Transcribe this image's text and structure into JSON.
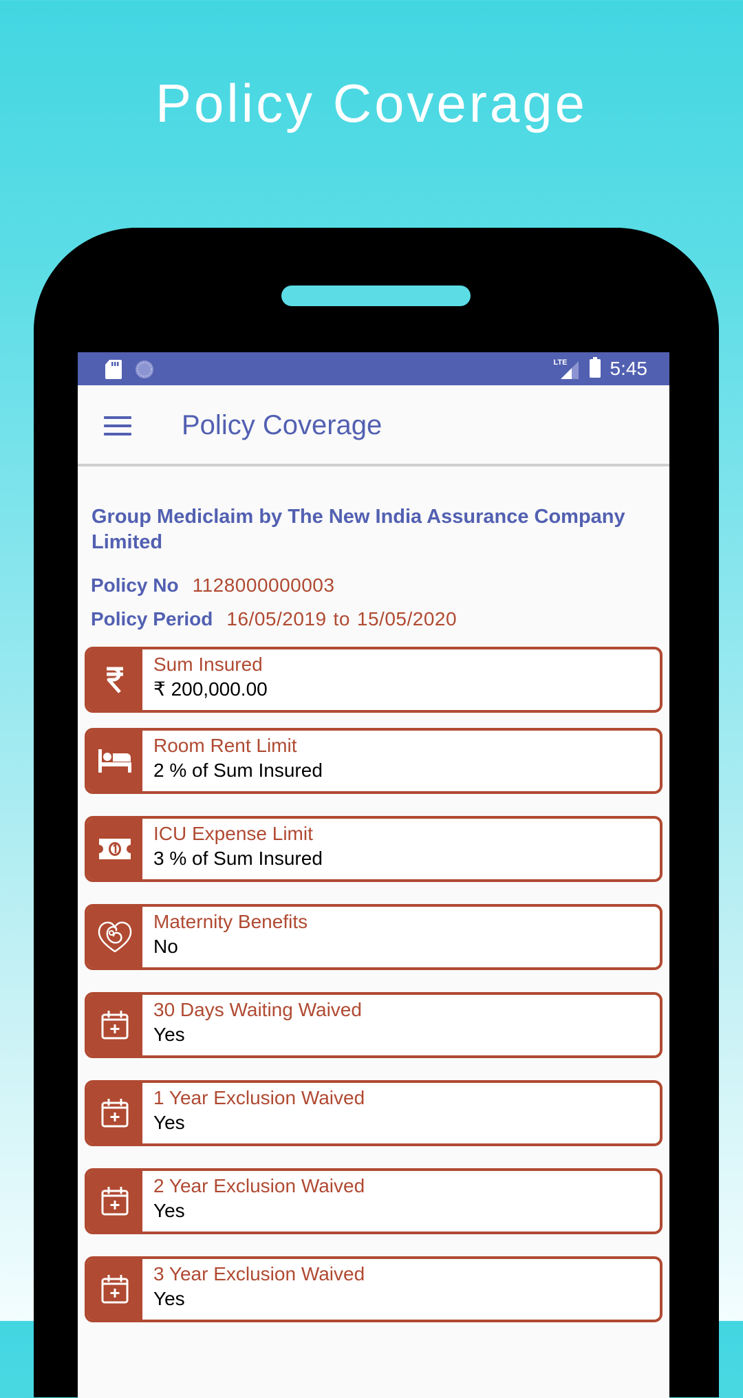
{
  "promo": {
    "title": "Policy Coverage"
  },
  "status_bar": {
    "time": "5:45",
    "network_label": "LTE",
    "icons": [
      "sd-card-icon",
      "sync-icon",
      "lte-signal-icon",
      "battery-icon"
    ]
  },
  "app_bar": {
    "title": "Policy Coverage",
    "menu_icon": "hamburger-menu-icon"
  },
  "policy": {
    "company": "Group Mediclaim by The New India Assurance Company Limited",
    "policy_no_label": "Policy No",
    "policy_no": "1128000000003",
    "period_label": "Policy Period",
    "period_start": "16/05/2019",
    "period_to": "to",
    "period_end": "15/05/2020"
  },
  "colors": {
    "primary": "#5260b1",
    "accent": "#b04a32",
    "background_top": "#42d6e1"
  },
  "coverage": [
    {
      "icon": "rupee-icon",
      "label": "Sum Insured",
      "value": "₹ 200,000.00"
    },
    {
      "icon": "bed-icon",
      "label": "Room Rent Limit",
      "value": "2 % of Sum Insured"
    },
    {
      "icon": "money-bill-icon",
      "label": "ICU Expense Limit",
      "value": "3 % of Sum Insured"
    },
    {
      "icon": "maternity-heart-icon",
      "label": "Maternity Benefits",
      "value": "No"
    },
    {
      "icon": "calendar-plus-icon",
      "label": "30 Days Waiting Waived",
      "value": "Yes"
    },
    {
      "icon": "calendar-plus-icon",
      "label": "1 Year Exclusion Waived",
      "value": "Yes"
    },
    {
      "icon": "calendar-plus-icon",
      "label": "2 Year Exclusion Waived",
      "value": "Yes"
    },
    {
      "icon": "calendar-plus-icon",
      "label": "3 Year Exclusion Waived",
      "value": "Yes"
    }
  ]
}
